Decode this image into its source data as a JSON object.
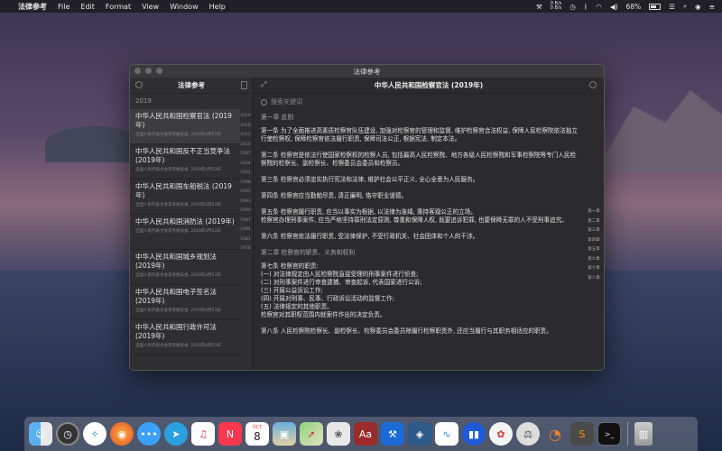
{
  "menubar": {
    "apple": "",
    "app_name": "法律参考",
    "menus": [
      "File",
      "Edit",
      "Format",
      "View",
      "Window",
      "Help"
    ],
    "net_up": "0 B/s",
    "net_down": "0 B/s",
    "battery": "68%"
  },
  "window": {
    "title": "法律参考"
  },
  "sidebar": {
    "title": "法律参考",
    "year_label": "2019",
    "items": [
      {
        "title": "中华人民共和国检察官法 (2019年)",
        "meta": "全国人民代表大会常务委员会, 2019年4月23日"
      },
      {
        "title": "中华人民共和国反不正当竞争法 (2019年)",
        "meta": "全国人民代表大会常务委员会, 2019年4月23日"
      },
      {
        "title": "中华人民共和国车船税法 (2019年)",
        "meta": "全国人民代表大会常务委员会, 2019年4月23日"
      },
      {
        "title": "中华人民共和国消防法 (2019年)",
        "meta": "全国人民代表大会常务委员会, 2019年4月23日"
      },
      {
        "title": "中华人民共和国城乡规划法 (2019年)",
        "meta": "全国人民代表大会常务委员会, 2019年4月23日"
      },
      {
        "title": "中华人民共和国电子签名法 (2019年)",
        "meta": "全国人民代表大会常务委员会, 2019年4月23日"
      },
      {
        "title": "中华人民共和国行政许可法 (2019年)",
        "meta": "全国人民代表大会常务委员会, 2019年4月23日"
      }
    ],
    "year_index": [
      "2019",
      "2018",
      "2015",
      "2010",
      "2007",
      "2004",
      "2001",
      "1998",
      "1995",
      "1993",
      "1990",
      "1987",
      "1984",
      "1981",
      "1978"
    ]
  },
  "main": {
    "title": "中华人民共和国检察官法 (2019年)",
    "search_placeholder": "搜索关键词",
    "chapter1": "第一章 总则",
    "p1": "第一条 为了全面推进高素质检察官队伍建设, 加强对检察官的管理和监督, 维护检察官合法权益, 保障人民检察院依法独立行使检察权, 保障检察官依法履行职责, 保障司法公正, 根据宪法, 制定本法。",
    "p2": "第二条 检察官是依法行使国家检察权的检察人员, 包括最高人民检察院、地方各级人民检察院和军事检察院等专门人民检察院的检察长、副检察长、检察委员会委员和检察员。",
    "p3": "第三条 检察官必须忠实执行宪法和法律, 维护社会公平正义, 全心全意为人民服务。",
    "p4": "第四条 检察官应当勤勉尽责, 清正廉明, 恪守职业道德。",
    "p5a": "第五条 检察官履行职责, 应当以事实为根据, 以法律为准绳, 秉持客观公正的立场。",
    "p5b": "检察官办理刑事案件, 应当严格坚持罪刑法定原则, 尊重和保障人权, 既要追诉犯罪, 也要保障无罪的人不受刑事追究。",
    "p6": "第六条 检察官依法履行职责, 受法律保护, 不受行政机关、社会团体和个人的干涉。",
    "chapter2": "第二章 检察官的职责、义务和权利",
    "p7": "第七条 检察官的职责:",
    "p7_1": "(一) 对法律规定由人民检察院直接受理的刑事案件进行侦查;",
    "p7_2": "(二) 对刑事案件进行审查逮捕、审查起诉, 代表国家进行公诉;",
    "p7_3": "(三) 开展公益诉讼工作;",
    "p7_4": "(四) 开展对刑事、民事、行政诉讼活动的监督工作;",
    "p7_5": "(五) 法律规定的其他职责。",
    "p7_6": "检察官对其职权范围内就案件作出的决定负责。",
    "p8": "第八条 人民检察院检察长、副检察长、检察委员会委员除履行检察职责外, 还应当履行与其职务相适应的职责。",
    "chapter_index": [
      "第一章",
      "第二章",
      "第三章",
      "第四章",
      "第五章",
      "第六章",
      "第七章",
      "第八章"
    ]
  },
  "dock": {
    "icons": [
      "finder-icon",
      "clock-icon",
      "safari-icon",
      "firefox-icon",
      "messages-icon",
      "telegram-icon",
      "music-icon",
      "news-icon",
      "calendar-icon",
      "preview-icon",
      "maps-icon",
      "photos-icon",
      "dictionary-icon",
      "xcode-icon",
      "instruments-icon",
      "waveform-icon",
      "stats-icon",
      "flower-icon",
      "scales-icon",
      "blender-icon",
      "sublime-icon",
      "terminal-icon",
      "trash-icon"
    ],
    "calendar_day": "8",
    "calendar_month": "OCT"
  }
}
